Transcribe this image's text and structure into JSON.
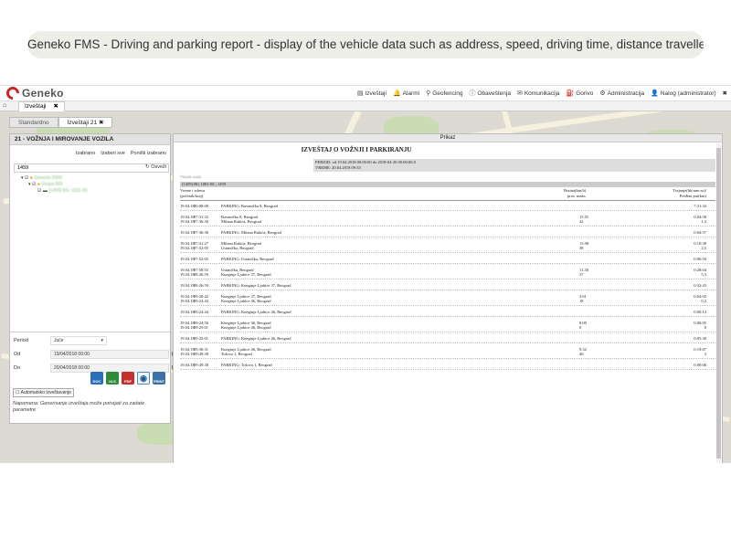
{
  "caption": "Geneko FMS - Driving and parking report - display of the vehicle data such as address, speed, driving time, distance travelled, etc.",
  "logo_text": "Geneko",
  "nav": [
    {
      "label": "Izveštaji",
      "icon": "report-icon"
    },
    {
      "label": "Alarmi",
      "icon": "bell-icon"
    },
    {
      "label": "Geofencing",
      "icon": "pin-icon"
    },
    {
      "label": "Obaveštenja",
      "icon": "info-icon"
    },
    {
      "label": "Komunikacija",
      "icon": "envelope-icon"
    },
    {
      "label": "Gorivo",
      "icon": "fuel-icon"
    },
    {
      "label": "Administracija",
      "icon": "gear-icon"
    },
    {
      "label": "Nalog (administrator)",
      "icon": "user-icon"
    }
  ],
  "main_tab": {
    "label": "Izveštaji"
  },
  "subtabs": [
    "Standardno",
    "Izveštaji 21"
  ],
  "left": {
    "title": "21 - VOŽNJA I MIROVANJE VOZILA",
    "actions": [
      "Izabrano",
      "Izaberi sve",
      "Poništi izabrano"
    ],
    "search_value": "1459",
    "refresh_label": "Osveži",
    "tree": [
      "Genexis 0000",
      "Grupa 000",
      "[1459] BG 1001-00"
    ],
    "period_label": "Period",
    "period_value": "Juče",
    "od_label": "Od",
    "od_value": "19/04/2018 00:00",
    "do_label": "Do",
    "do_value": "20/04/2018 00:00",
    "export": [
      "DOC",
      "XLS",
      "PDF",
      "",
      "PRINT"
    ],
    "auto_label": "Automatsko izveštavanje",
    "note": "Napomena: Generisanje izveštaja može potrajati za zadate parametre"
  },
  "prikaz": {
    "header": "Prikaz",
    "title": "IZVEŠTAJ O VOŽNJI I PARKIRANJU",
    "period_line": "PERIOD: od 19.04.2018 00:00:00 do 2018-04-20 00:00:00.0",
    "vreme_line": "VREME: 20.04.2018 09:33",
    "hidden_line": "Vlasnik vozila",
    "vehicle_line": "(1459) BG 1001-00 ; 1459",
    "col_time": "Vreme i adresa",
    "col_time2": "(početak/kraj)",
    "col_speed": "Brzina(km/h)",
    "col_speed2": "pros. maks.",
    "col_dur": "Trajanje(hh:mm:ss)/",
    "col_dur2": "Pređeni put(km)",
    "groups": [
      [
        [
          "19.04.18",
          "00:00:00",
          "PARKING: Ravanička 8, Beograd",
          "",
          "7:31:32"
        ]
      ],
      [
        [
          "19.04.18",
          "07:31:32",
          "Ravanička 8, Beograd",
          "15.55",
          "0:04:58"
        ],
        [
          "19.04.18",
          "07:36:30",
          "Milana Rakića, Beograd",
          "42",
          "1,3"
        ]
      ],
      [
        [
          "19.04.18",
          "07:36:30",
          "PARKING: Milana Rakića, Beograd",
          "",
          "0:04:57"
        ]
      ],
      [
        [
          "19.04.18",
          "07:41:27",
          "Milana Rakića, Beograd",
          "13.98",
          "0:10:38"
        ],
        [
          "19.04.18",
          "07:52:05",
          "Ustanička, Beograd",
          "38",
          "2,5"
        ]
      ],
      [
        [
          "19.04.18",
          "07:52:05",
          "PARKING: Ustanička, Beograd",
          "",
          "0:06:50"
        ]
      ],
      [
        [
          "19.04.18",
          "07:58:55",
          "Ustanička, Beograd",
          "11.30",
          "0:28:04"
        ],
        [
          "19.04.18",
          "08:26:59",
          "Kneginje Ljubice 37, Beograd",
          "37",
          "5,3"
        ]
      ],
      [
        [
          "19.04.18",
          "08:26:59",
          "PARKING: Kneginje Ljubice 37, Beograd",
          "",
          "0:32:43"
        ]
      ],
      [
        [
          "19.04.18",
          "09:20:42",
          "Kneginje Ljubice 37, Beograd",
          "3.61",
          "0:04:02"
        ],
        [
          "19.04.18",
          "09:24:44",
          "Kneginje Ljubice 46, Beograd",
          "18",
          "0,2"
        ]
      ],
      [
        [
          "19.04.18",
          "09:24:44",
          "PARKING: Kneginje Ljubice 46, Beograd",
          "",
          "0:00:12"
        ]
      ],
      [
        [
          "19.04.18",
          "09:24:56",
          "Kneginje Ljubice 46, Beograd",
          "0.00",
          "0:00:05"
        ],
        [
          "19.04.18",
          "09:25:01",
          "Kneginje Ljubice 46, Beograd",
          "0",
          "0"
        ]
      ],
      [
        [
          "19.04.18",
          "09:25:01",
          "PARKING: Kneginje Ljubice 46, Beograd",
          "",
          "0:05:30"
        ]
      ],
      [
        [
          "19.04.18",
          "09:30:31",
          "Kneginje Ljubice 46, Beograd",
          "9.32",
          "0:19:07"
        ],
        [
          "19.04.18",
          "09:49:38",
          "Tošova 1, Beograd",
          "46",
          "3"
        ]
      ],
      [
        [
          "19.04.18",
          "09:49:38",
          "PARKING: Tošova 1, Beograd",
          "",
          "0:00:06"
        ]
      ]
    ]
  }
}
